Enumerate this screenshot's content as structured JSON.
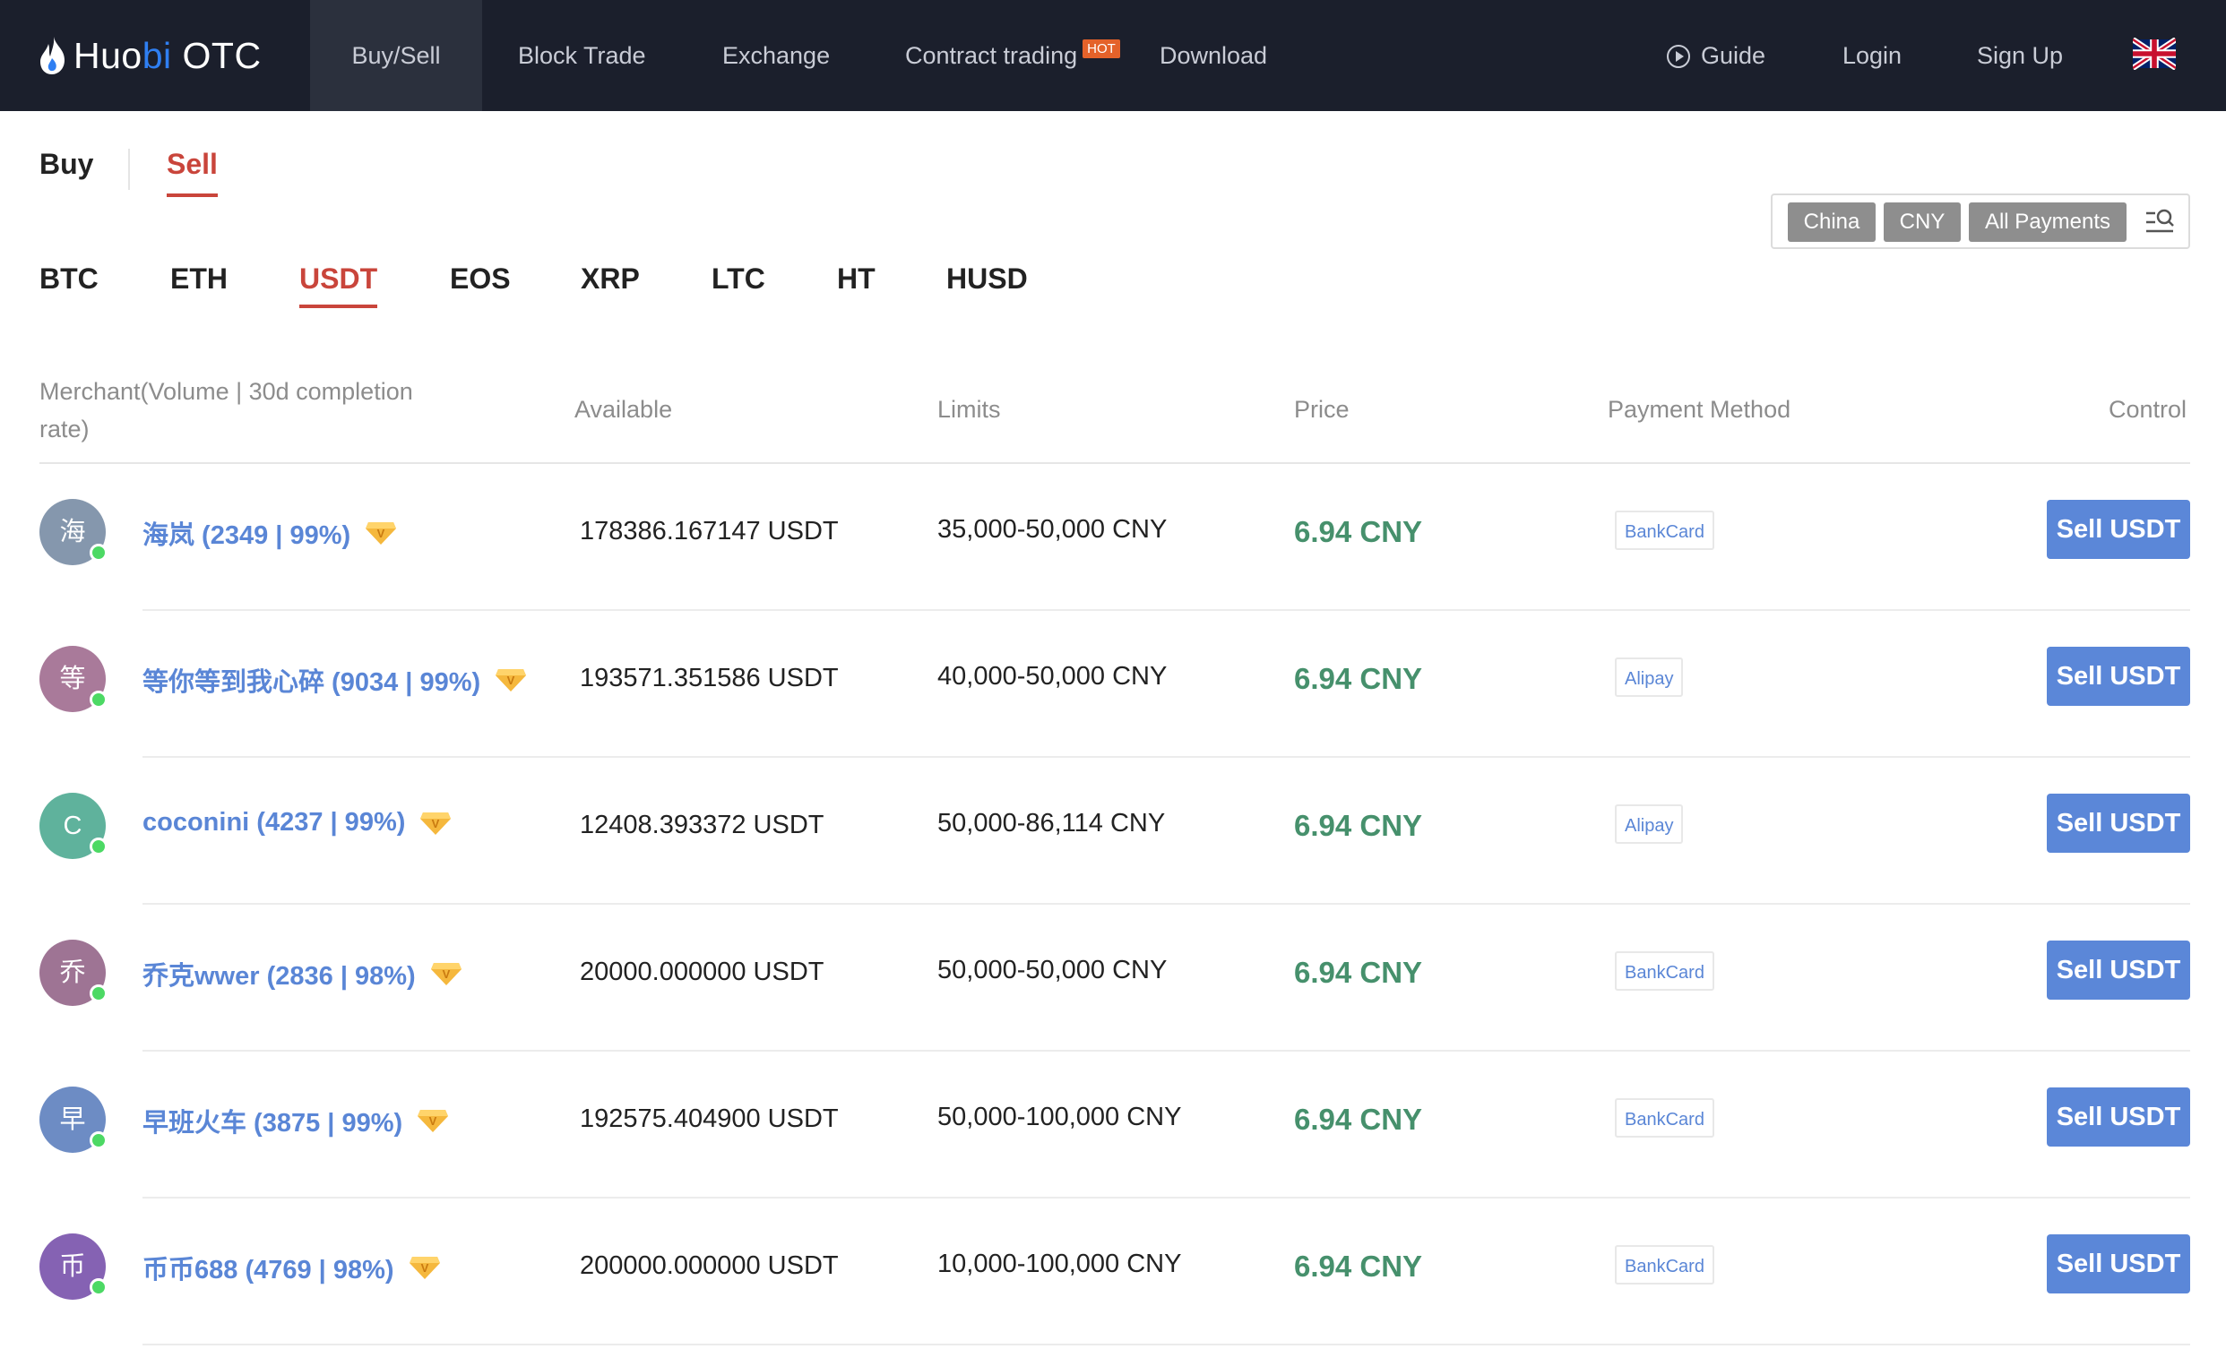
{
  "brand": {
    "part1": "Huo",
    "part2": "bi",
    "part3": " OTC"
  },
  "nav": {
    "items": [
      "Buy/Sell",
      "Block Trade",
      "Exchange",
      "Contract trading",
      "Download"
    ],
    "hot_badge": "HOT",
    "guide": "Guide",
    "login": "Login",
    "signup": "Sign Up",
    "language_flag_icon": "uk-flag-icon"
  },
  "mode_tabs": {
    "buy": "Buy",
    "sell": "Sell",
    "active": "Sell"
  },
  "coins": [
    "BTC",
    "ETH",
    "USDT",
    "EOS",
    "XRP",
    "LTC",
    "HT",
    "HUSD"
  ],
  "active_coin": "USDT",
  "filter": {
    "country": "China",
    "currency": "CNY",
    "payment": "All Payments",
    "icon": "search-filter-icon"
  },
  "table": {
    "headers": {
      "merchant_line1": "Merchant(Volume | 30d completion",
      "merchant_line2": "rate)",
      "available": "Available",
      "limits": "Limits",
      "price": "Price",
      "payment": "Payment Method",
      "control": "Control"
    },
    "rows": [
      {
        "initial": "海",
        "color": "#8597ad",
        "merchant": "海岚 (2349 | 99%)",
        "available": "178386.167147 USDT",
        "limits": "35,000-50,000 CNY",
        "price": "6.94 CNY",
        "payment": "BankCard",
        "action": "Sell USDT"
      },
      {
        "initial": "等",
        "color": "#a97a9a",
        "merchant": "等你等到我心碎 (9034 | 99%)",
        "available": "193571.351586 USDT",
        "limits": "40,000-50,000 CNY",
        "price": "6.94 CNY",
        "payment": "Alipay",
        "action": "Sell USDT"
      },
      {
        "initial": "C",
        "color": "#5fb29c",
        "merchant": "coconini (4237 | 99%)",
        "available": "12408.393372 USDT",
        "limits": "50,000-86,114 CNY",
        "price": "6.94 CNY",
        "payment": "Alipay",
        "action": "Sell USDT"
      },
      {
        "initial": "乔",
        "color": "#9e7494",
        "merchant": "乔克wwer (2836 | 98%)",
        "available": "20000.000000 USDT",
        "limits": "50,000-50,000 CNY",
        "price": "6.94 CNY",
        "payment": "BankCard",
        "action": "Sell USDT"
      },
      {
        "initial": "早",
        "color": "#6d8cc4",
        "merchant": "早班火车 (3875 | 99%)",
        "available": "192575.404900 USDT",
        "limits": "50,000-100,000 CNY",
        "price": "6.94 CNY",
        "payment": "BankCard",
        "action": "Sell USDT"
      },
      {
        "initial": "币",
        "color": "#8562b3",
        "merchant": "币币688 (4769 | 98%)",
        "available": "200000.000000 USDT",
        "limits": "10,000-100,000 CNY",
        "price": "6.94 CNY",
        "payment": "BankCard",
        "action": "Sell USDT"
      }
    ]
  },
  "colors": {
    "nav_bg": "#1b1f2c",
    "accent_red": "#c9453b",
    "link_blue": "#5a86d6",
    "price_green": "#46906c",
    "button_blue": "#5b87d8"
  }
}
